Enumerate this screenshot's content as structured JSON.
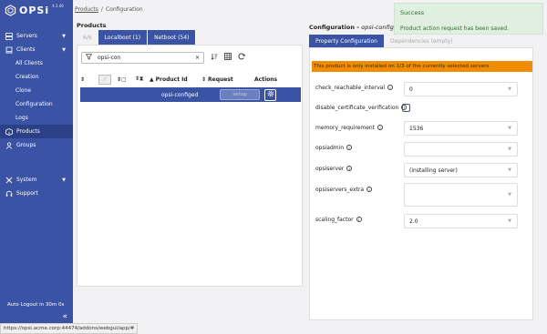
{
  "brand": {
    "name": "OPSi",
    "version": "4.3.46"
  },
  "sidebar": {
    "items": [
      {
        "label": "Servers",
        "icon": "server-icon"
      },
      {
        "label": "Clients",
        "icon": "laptop-icon"
      }
    ],
    "client_subitems": [
      "All Clients",
      "Creation",
      "Clone",
      "Configuration",
      "Logs"
    ],
    "products_label": "Products",
    "groups_label": "Groups",
    "system_label": "System",
    "support_label": "Support",
    "autologout": "Auto Logout in 30m 0s"
  },
  "breadcrumb": {
    "products": "Products",
    "separator": "/",
    "current": "Configuration"
  },
  "products": {
    "title": "Products",
    "depot_tabs": [
      {
        "label": "6/6"
      },
      {
        "label": "Localboot (1)"
      },
      {
        "label": "Netboot (54)"
      }
    ],
    "search_value": "opsi-con",
    "clear": "×",
    "columns": {
      "product_id": "Product Id",
      "request": "Request",
      "actions": "Actions"
    },
    "row": {
      "product_id": "opsi-configed",
      "request": "setup"
    }
  },
  "configuration": {
    "title": "Configuration -",
    "product": "opsi-configed",
    "tabs": [
      "Property Configuration",
      "Dependencies (empty)"
    ],
    "warning": "This product is only installed on 1/3 of the currently selected servers",
    "properties": [
      {
        "label": "check_reachable_interval",
        "value": "0"
      },
      {
        "label": "disable_certificate_verification",
        "value": ""
      },
      {
        "label": "memory_requirement",
        "value": "1536"
      },
      {
        "label": "opsiadmin",
        "value": ""
      },
      {
        "label": "opsiserver",
        "value": "(installing server)"
      },
      {
        "label": "opsiservers_extra",
        "value": ""
      },
      {
        "label": "scaling_factor",
        "value": "2.0"
      }
    ]
  },
  "toast": {
    "title": "Success",
    "message": "Product action request has been saved."
  },
  "status_url": "https://opsi.acme.corp:44474/addons/webgui/app/#"
}
